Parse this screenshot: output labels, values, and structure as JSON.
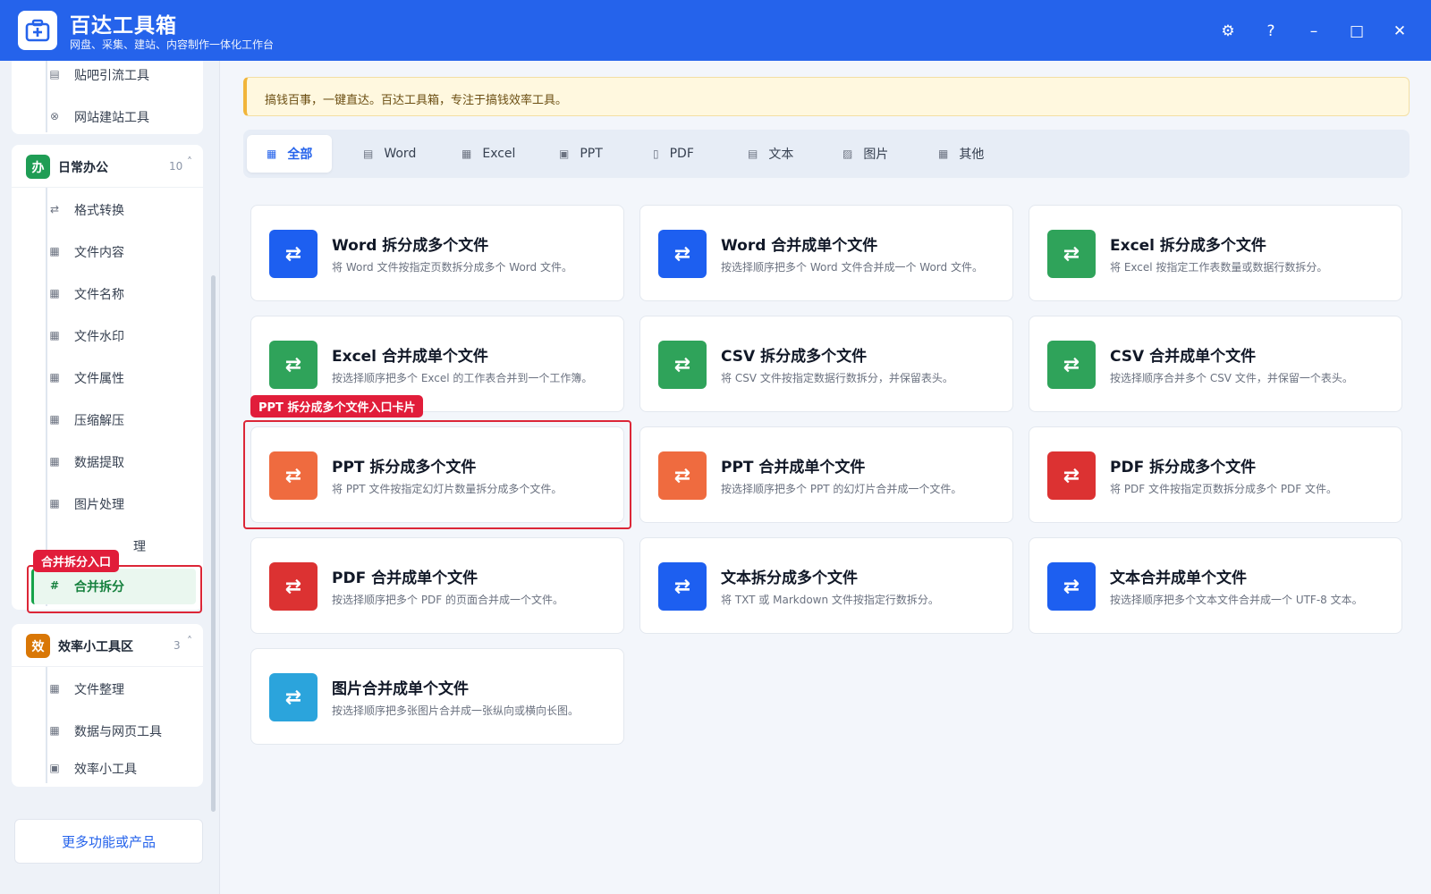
{
  "app": {
    "title": "百达工具箱",
    "subtitle": "网盘、采集、建站、内容制作一体化工作台"
  },
  "window_controls": {
    "settings": "⚙",
    "help": "?",
    "minimize": "–",
    "maximize": "□",
    "close": "✕"
  },
  "sidebar": {
    "top_group_items": [
      {
        "label": "贴吧引流工具",
        "icon": "▤"
      },
      {
        "label": "网站建站工具",
        "icon": "⊗"
      }
    ],
    "groups": [
      {
        "badge": "办",
        "badge_color": "#1f9d55",
        "title": "日常办公",
        "count": "10",
        "caret": "˄",
        "items": [
          {
            "label": "格式转换",
            "icon": "⇄"
          },
          {
            "label": "文件内容",
            "icon": "▦"
          },
          {
            "label": "文件名称",
            "icon": "▦"
          },
          {
            "label": "文件水印",
            "icon": "▦"
          },
          {
            "label": "文件属性",
            "icon": "▦"
          },
          {
            "label": "压缩解压",
            "icon": "▦"
          },
          {
            "label": "数据提取",
            "icon": "▦"
          },
          {
            "label": "图片处理",
            "icon": "▦"
          },
          {
            "label": "理",
            "icon": ""
          },
          {
            "label": "合并拆分",
            "icon": "#"
          }
        ]
      },
      {
        "badge": "效",
        "badge_color": "#d97706",
        "title": "效率小工具区",
        "count": "3",
        "caret": "˄",
        "items": [
          {
            "label": "文件整理",
            "icon": "▦"
          },
          {
            "label": "数据与网页工具",
            "icon": "▦"
          },
          {
            "label": "效率小工具",
            "icon": "▣"
          }
        ]
      }
    ],
    "more_button": "更多功能或产品"
  },
  "notice": "搞钱百事，一键直达。百达工具箱，专注于搞钱效率工具。",
  "tabs": [
    {
      "label": "全部",
      "icon": "▦"
    },
    {
      "label": "Word",
      "icon": "▤"
    },
    {
      "label": "Excel",
      "icon": "▦"
    },
    {
      "label": "PPT",
      "icon": "▣"
    },
    {
      "label": "PDF",
      "icon": "▯"
    },
    {
      "label": "文本",
      "icon": "▤"
    },
    {
      "label": "图片",
      "icon": "▨"
    },
    {
      "label": "其他",
      "icon": "▦"
    }
  ],
  "colors": {
    "blue": "#1d5ff0",
    "green": "#2fa35a",
    "orange": "#ef6b3f",
    "red": "#dc3232",
    "sky": "#2ba4dc",
    "highlight": "#dc2637"
  },
  "cards": [
    {
      "title": "Word 拆分成多个文件",
      "desc": "将 Word 文件按指定页数拆分成多个 Word 文件。",
      "color": "#1d5ff0",
      "icon": "⇄"
    },
    {
      "title": "Word 合并成单个文件",
      "desc": "按选择顺序把多个 Word 文件合并成一个 Word 文件。",
      "color": "#1d5ff0",
      "icon": "⇄"
    },
    {
      "title": "Excel 拆分成多个文件",
      "desc": "将 Excel 按指定工作表数量或数据行数拆分。",
      "color": "#2fa35a",
      "icon": "⇄"
    },
    {
      "title": "Excel 合并成单个文件",
      "desc": "按选择顺序把多个 Excel 的工作表合并到一个工作簿。",
      "color": "#2fa35a",
      "icon": "⇄"
    },
    {
      "title": "CSV 拆分成多个文件",
      "desc": "将 CSV 文件按指定数据行数拆分，并保留表头。",
      "color": "#2fa35a",
      "icon": "⇄"
    },
    {
      "title": "CSV 合并成单个文件",
      "desc": "按选择顺序合并多个 CSV 文件，并保留一个表头。",
      "color": "#2fa35a",
      "icon": "⇄"
    },
    {
      "title": "PPT 拆分成多个文件",
      "desc": "将 PPT 文件按指定幻灯片数量拆分成多个文件。",
      "color": "#ef6b3f",
      "icon": "⇄"
    },
    {
      "title": "PPT 合并成单个文件",
      "desc": "按选择顺序把多个 PPT 的幻灯片合并成一个文件。",
      "color": "#ef6b3f",
      "icon": "⇄"
    },
    {
      "title": "PDF 拆分成多个文件",
      "desc": "将 PDF 文件按指定页数拆分成多个 PDF 文件。",
      "color": "#dc3232",
      "icon": "⇄"
    },
    {
      "title": "PDF 合并成单个文件",
      "desc": "按选择顺序把多个 PDF 的页面合并成一个文件。",
      "color": "#dc3232",
      "icon": "⇄"
    },
    {
      "title": "文本拆分成多个文件",
      "desc": "将 TXT 或 Markdown 文件按指定行数拆分。",
      "color": "#1d5ff0",
      "icon": "⇄"
    },
    {
      "title": "文本合并成单个文件",
      "desc": "按选择顺序把多个文本文件合并成一个 UTF-8 文本。",
      "color": "#1d5ff0",
      "icon": "⇄"
    },
    {
      "title": "图片合并成单个文件",
      "desc": "按选择顺序把多张图片合并成一张纵向或横向长图。",
      "color": "#2ba4dc",
      "icon": "⇄"
    }
  ],
  "annotations": {
    "ppt_card_label": "PPT 拆分成多个文件入口卡片",
    "merge_split_label": "合并拆分入口"
  }
}
